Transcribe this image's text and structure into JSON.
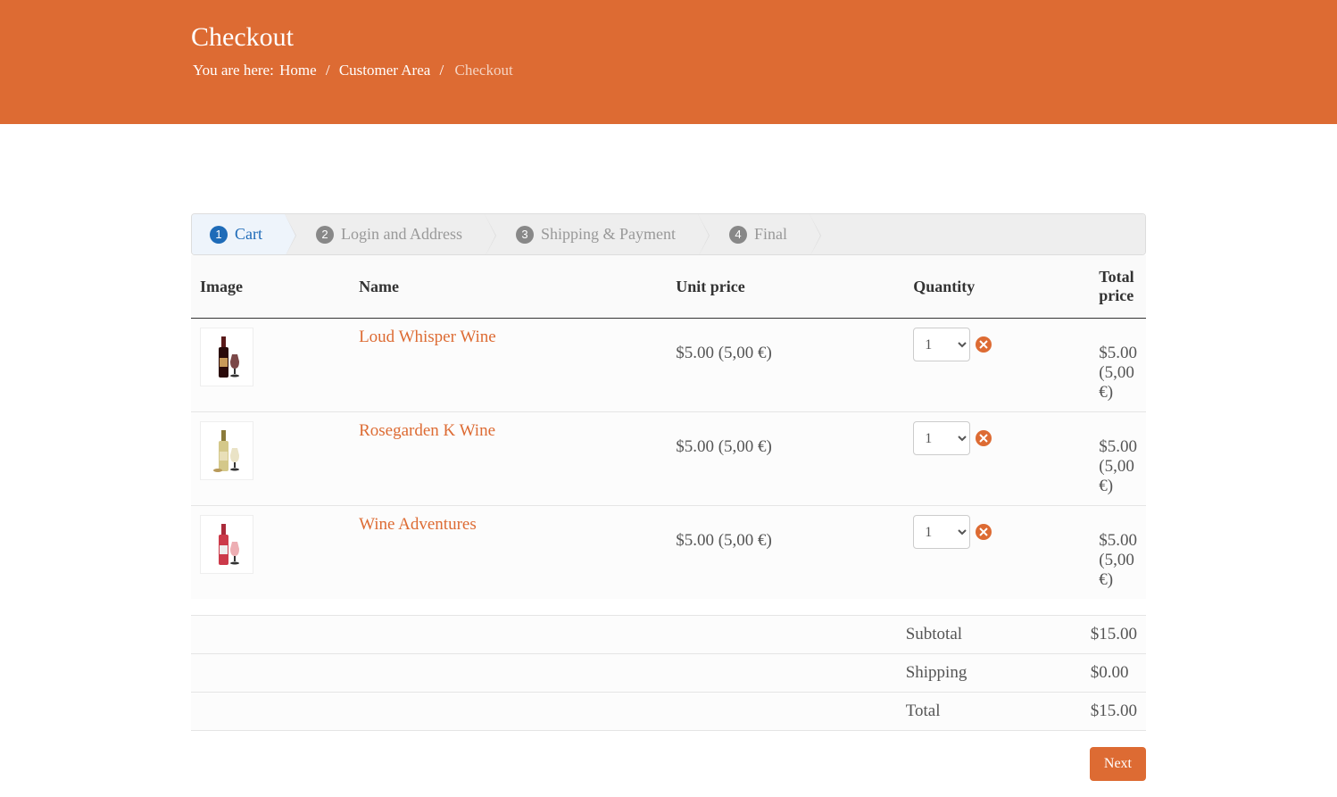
{
  "header": {
    "title": "Checkout",
    "breadcrumb": {
      "label": "You are here:",
      "home": "Home",
      "customer_area": "Customer Area",
      "current": "Checkout",
      "separator": "/"
    }
  },
  "steps": [
    {
      "number": "1",
      "label": "Cart",
      "active": true
    },
    {
      "number": "2",
      "label": "Login and Address",
      "active": false
    },
    {
      "number": "3",
      "label": "Shipping & Payment",
      "active": false
    },
    {
      "number": "4",
      "label": "Final",
      "active": false
    }
  ],
  "columns": {
    "image": "Image",
    "name": "Name",
    "unit_price": "Unit price",
    "quantity": "Quantity",
    "total_price": "Total price"
  },
  "items": [
    {
      "name": "Loud Whisper Wine",
      "unit_price": "$5.00 (5,00 €)",
      "quantity": "1",
      "total_price": "$5.00 (5,00 €)",
      "color": "dark"
    },
    {
      "name": "Rosegarden K Wine",
      "unit_price": "$5.00 (5,00 €)",
      "quantity": "1",
      "total_price": "$5.00 (5,00 €)",
      "color": "white"
    },
    {
      "name": "Wine Adventures",
      "unit_price": "$5.00 (5,00 €)",
      "quantity": "1",
      "total_price": "$5.00 (5,00 €)",
      "color": "red"
    }
  ],
  "totals": {
    "subtotal_label": "Subtotal",
    "subtotal_value": "$15.00",
    "shipping_label": "Shipping",
    "shipping_value": "$0.00",
    "total_label": "Total",
    "total_value": "$15.00"
  },
  "buttons": {
    "next": "Next"
  }
}
